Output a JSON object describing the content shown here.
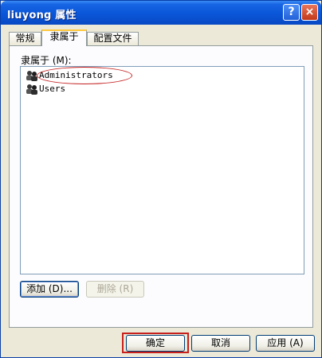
{
  "window": {
    "title": "liuyong 属性",
    "help_label": "?",
    "close_label": "×"
  },
  "tabs": [
    {
      "label": "常规",
      "active": false
    },
    {
      "label": "隶属于",
      "active": true
    },
    {
      "label": "配置文件",
      "active": false
    }
  ],
  "member_of": {
    "label": "隶属于 (M):",
    "groups": [
      {
        "name": "Administrators",
        "icon": "group-icon",
        "highlighted": true
      },
      {
        "name": "Users",
        "icon": "group-icon",
        "highlighted": false
      }
    ]
  },
  "panel_buttons": {
    "add": "添加 (D)...",
    "remove": "删除 (R)"
  },
  "footer_buttons": {
    "ok": "确定",
    "cancel": "取消",
    "apply": "应用 (A)"
  },
  "colors": {
    "titlebar": "#0a56d8",
    "accent_tab": "#ffc83c",
    "annotation": "#c42020"
  }
}
